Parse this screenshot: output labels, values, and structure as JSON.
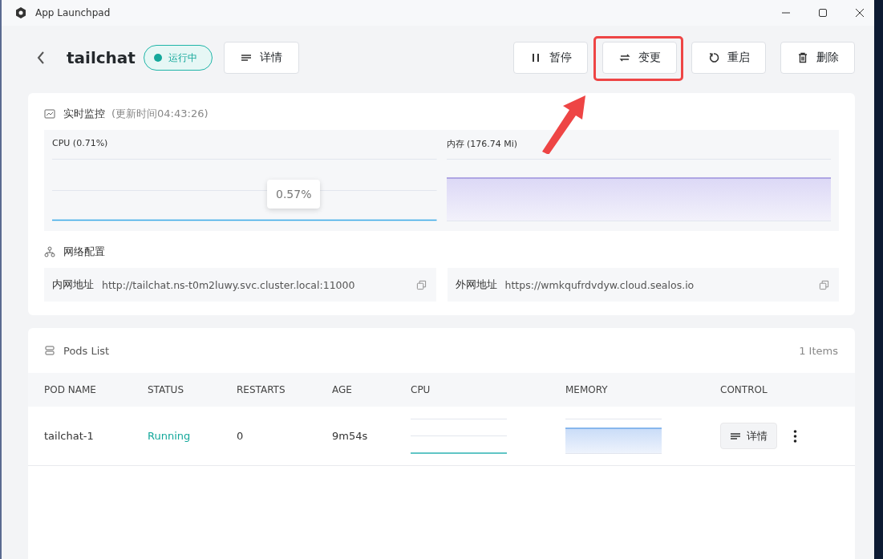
{
  "window": {
    "title": "App Launchpad"
  },
  "header": {
    "app_name": "tailchat",
    "status": "运行中",
    "details_button": "详情",
    "actions": [
      {
        "kind": "pause",
        "label": "暂停",
        "highlighted": false
      },
      {
        "kind": "change",
        "label": "变更",
        "highlighted": true
      },
      {
        "kind": "restart",
        "label": "重启",
        "highlighted": false
      },
      {
        "kind": "delete",
        "label": "删除",
        "highlighted": false
      }
    ]
  },
  "monitor": {
    "title": "实时监控",
    "updated": "(更新时间04:43:26)",
    "charts": [
      {
        "kind": "cpu",
        "label": "CPU  (0.71%)",
        "tooltip": "0.57%"
      },
      {
        "kind": "memory",
        "label": "内存  (176.74 Mi)"
      }
    ]
  },
  "network": {
    "title": "网络配置",
    "addresses": [
      {
        "label": "内网地址",
        "value": "http://tailchat.ns-t0m2luwy.svc.cluster.local:11000"
      },
      {
        "label": "外网地址",
        "value": "https://wmkqufrdvdyw.cloud.sealos.io"
      }
    ]
  },
  "pods": {
    "title": "Pods List",
    "count": "1 Items",
    "columns": [
      "POD NAME",
      "STATUS",
      "RESTARTS",
      "AGE",
      "CPU",
      "MEMORY",
      "CONTROL"
    ],
    "rows": [
      {
        "name": "tailchat-1",
        "status": "Running",
        "restarts": "0",
        "age": "9m54s",
        "details_button": "详情"
      }
    ]
  }
}
